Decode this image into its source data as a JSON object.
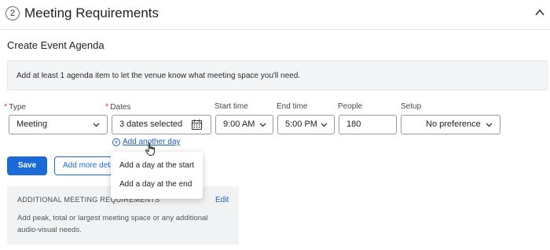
{
  "section": {
    "step": "2",
    "title": "Meeting Requirements"
  },
  "agenda": {
    "title": "Create Event Agenda",
    "info": "Add at least 1 agenda item to let the venue know what meeting space you'll need."
  },
  "form": {
    "type": {
      "label": "Type",
      "value": "Meeting"
    },
    "dates": {
      "label": "Dates",
      "value": "3 dates selected"
    },
    "start_time": {
      "label": "Start time",
      "value": "9:00 AM"
    },
    "end_time": {
      "label": "End time",
      "value": "5:00 PM"
    },
    "people": {
      "label": "People",
      "value": "180"
    },
    "setup": {
      "label": "Setup",
      "value": "No preference"
    },
    "required_marker": "*"
  },
  "add_day": {
    "label": "Add another day",
    "icon": "plus-circle-icon"
  },
  "buttons": {
    "save": "Save",
    "more_details": "Add more details"
  },
  "dropdown_menu": {
    "items": [
      "Add a day at the start",
      "Add a day at the end"
    ]
  },
  "additional": {
    "heading": "ADDITIONAL MEETING REQUIREMENTS",
    "edit": "Edit",
    "description": "Add peak, total or largest meeting space or any additional audio-visual needs."
  },
  "colors": {
    "primary": "#1b6ad8",
    "link": "#1a5fb4",
    "required": "#d9534f",
    "banner_bg": "#f4f5f6"
  }
}
